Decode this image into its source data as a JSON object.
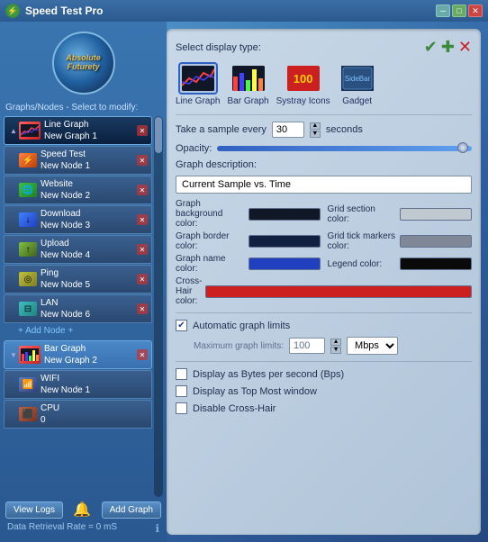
{
  "window": {
    "title": "Speed Test Pro",
    "icon": "⚡"
  },
  "sidebar": {
    "heading": "Graphs/Nodes - Select to modify:",
    "logo_text": "Absolute\nFuturety",
    "groups": [
      {
        "name": "Line Graph",
        "subname": "New Graph 1",
        "active": true,
        "nodes": [
          {
            "name": "Speed Test",
            "subname": "New Node 1",
            "icon": "⚡"
          },
          {
            "name": "Website",
            "subname": "New Node 2",
            "icon": "🌐"
          },
          {
            "name": "Download",
            "subname": "New Node 3",
            "icon": "↓"
          },
          {
            "name": "Upload",
            "subname": "New Node 4",
            "icon": "↑"
          },
          {
            "name": "Ping",
            "subname": "New Node 5",
            "icon": "◎"
          },
          {
            "name": "LAN",
            "subname": "New Node 6",
            "icon": "⊟"
          }
        ]
      },
      {
        "name": "Bar Graph",
        "subname": "New Graph 2",
        "active": false,
        "nodes": [
          {
            "name": "WIFI",
            "subname": "New Node 1",
            "icon": "📶"
          },
          {
            "name": "CPU",
            "subname": "0",
            "icon": "⬛"
          }
        ]
      }
    ],
    "add_node_label": "+ Add Node +",
    "view_logs_label": "View Logs",
    "add_graph_label": "Add Graph",
    "status": "Data Retrieval Rate = 0 mS"
  },
  "panel": {
    "display_type_label": "Select display type:",
    "check_icon": "✔",
    "plus_icon": "✚",
    "x_icon": "✕",
    "types": [
      {
        "label": "Line Graph",
        "selected": true
      },
      {
        "label": "Bar Graph",
        "selected": false
      },
      {
        "label": "Systray Icons",
        "selected": false
      },
      {
        "label": "Gadget",
        "selected": false
      }
    ],
    "sample_label": "Take a sample every",
    "sample_value": "30",
    "sample_unit": "seconds",
    "opacity_label": "Opacity:",
    "graph_desc_label": "Graph description:",
    "graph_desc_value": "Current Sample vs. Time",
    "bg_color_label": "Graph background color:",
    "grid_color_label": "Grid section color:",
    "border_color_label": "Graph border color:",
    "tick_color_label": "Grid tick markers color:",
    "name_color_label": "Graph name color:",
    "legend_color_label": "Legend color:",
    "crosshair_color_label": "Cross-Hair color:",
    "auto_limits_label": "Automatic graph limits",
    "max_graph_label": "Maximum graph limits:",
    "max_value": "100",
    "max_unit": "Mbps",
    "display_bytes_label": "Display as Bytes per second (Bps)",
    "top_most_label": "Display as Top Most window",
    "disable_crosshair_label": "Disable Cross-Hair"
  }
}
